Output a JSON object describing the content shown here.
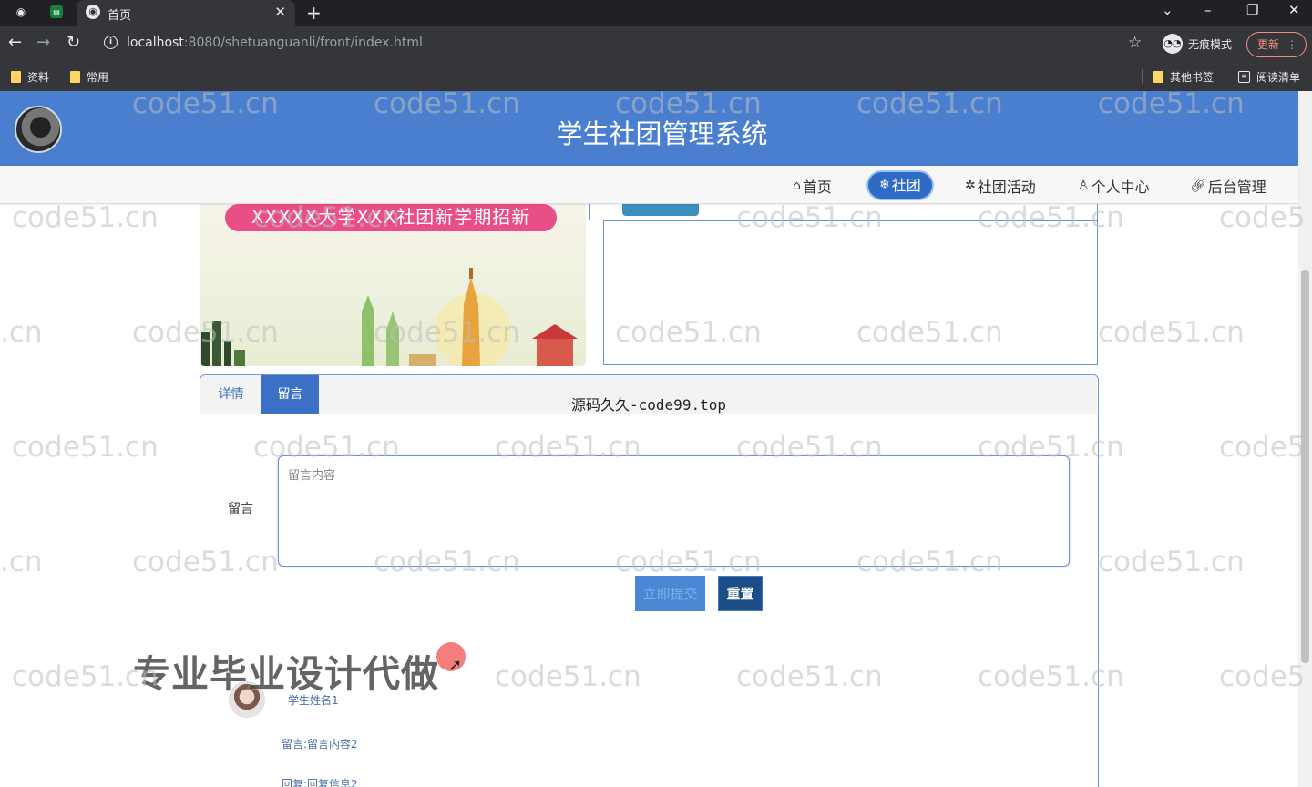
{
  "browser": {
    "tab_title": "首页",
    "url_host": "localhost",
    "url_path": ":8080/shetuanguanli/front/index.html",
    "incognito_label": "无痕模式",
    "update_label": "更新",
    "bookmarks": [
      "资料",
      "常用"
    ],
    "other_bookmarks": "其他书签",
    "reading_list": "阅读清单"
  },
  "site": {
    "title": "学生社团管理系统",
    "nav": [
      {
        "label": "首页",
        "icon": "home-icon"
      },
      {
        "label": "社团",
        "icon": "snowflake-icon"
      },
      {
        "label": "社团活动",
        "icon": "sparkle-icon"
      },
      {
        "label": "个人中心",
        "icon": "user-icon"
      },
      {
        "label": "后台管理",
        "icon": "link-icon"
      }
    ]
  },
  "banner": {
    "headline": "XXXXX大学XXX社团新学期招新"
  },
  "panel": {
    "tabs": [
      "详情",
      "留言"
    ],
    "active_tab": "留言",
    "overlay_text": "源码久久-code99.top",
    "form": {
      "label": "留言",
      "placeholder": "留言内容",
      "submit_label": "立即提交",
      "reset_label": "重置"
    },
    "comments": [
      {
        "name": "学生姓名1",
        "content": "留言:留言内容2",
        "reply": "回复:回复信息2"
      }
    ]
  },
  "overlay": {
    "promo": "专业毕业设计代做",
    "watermark": "code51.cn",
    "watermark_partial_left": ".cn",
    "watermark_partial_right": "code5"
  },
  "colors": {
    "header_bg": "#4a7fd0",
    "nav_active": "#2f6bc4",
    "banner_ribbon": "#e94f86"
  }
}
